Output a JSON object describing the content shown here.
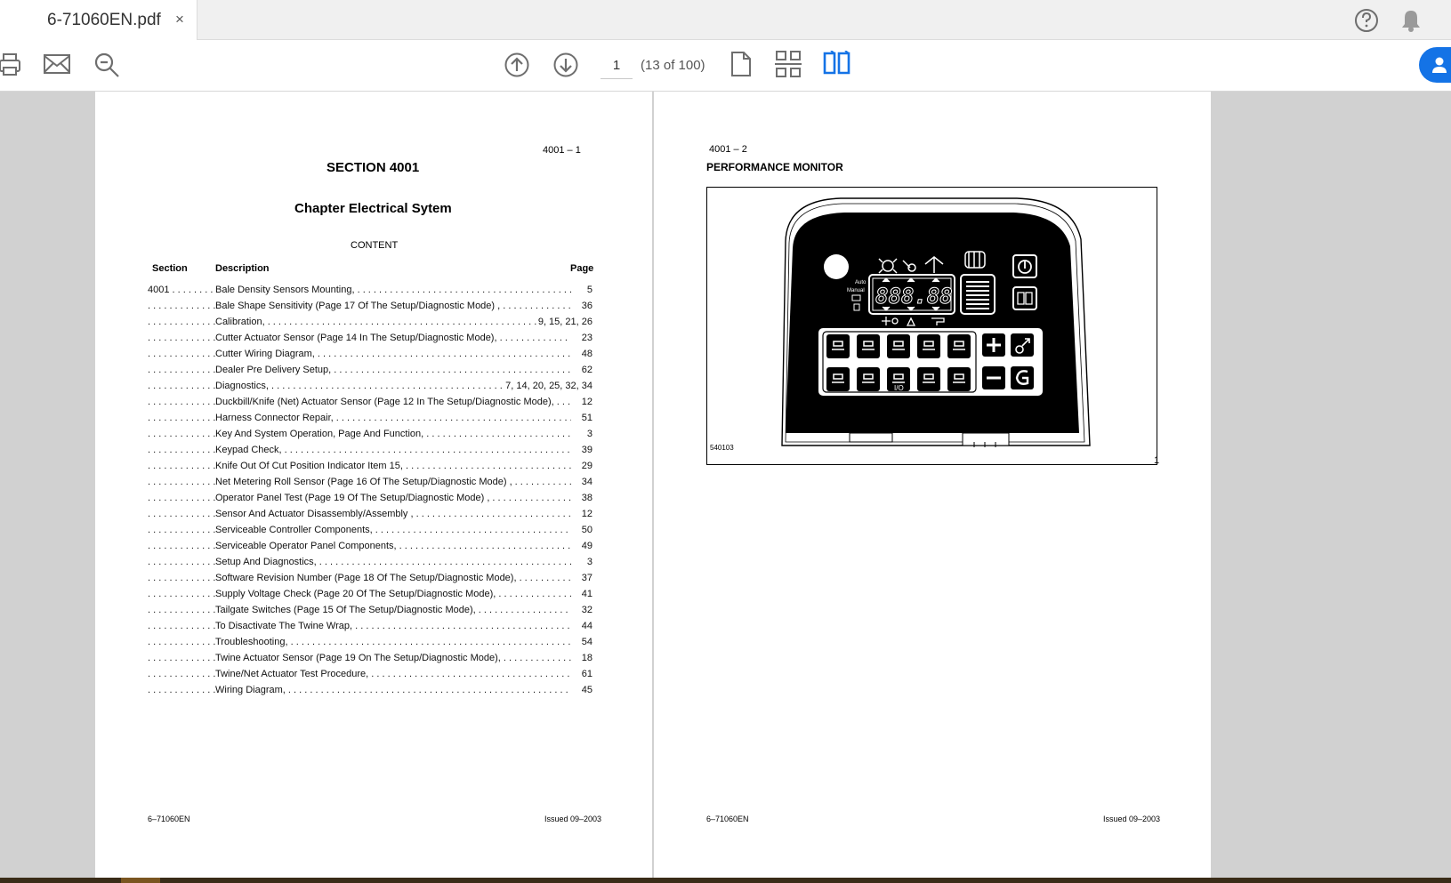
{
  "tab": {
    "title": "6-71060EN.pdf",
    "close": "×"
  },
  "toolbar": {
    "page_input": "1",
    "page_count": "(13 of 100)"
  },
  "left_page": {
    "header_code": "4001 – 1",
    "section_title": "SECTION  4001",
    "chapter_title": "Chapter  Electrical Sytem",
    "content_label": "CONTENT",
    "col_section": "Section",
    "col_description": "Description",
    "col_page": "Page",
    "toc": [
      {
        "sec": "4001 . . . . . . . . . . . . . .",
        "desc": "Bale Density Sensors Mounting,  . . . . . . . . . . . . . . . . . . . . . . . . . . . . . . . . . . . . . . . . . . . . . . . . . . . . . . . . . . .",
        "page": "5"
      },
      {
        "sec": ". . . . . . . . . . . . . . . . . . . .",
        "desc": "Bale Shape Sensitivity (Page 17 Of The  Setup/Diagnostic Mode) ,  . . . . . . . . . . . . . . . . . . . . . . . . . . . . .",
        "page": "36"
      },
      {
        "sec": ". . . . . . . . . . . . . . . . . . . .",
        "desc": "Calibration,  . . . . . . . . . . . . . . . . . . . . . . . . . . . . . . . . . . . . . . . . . . . . . . . . . . . . . . . . . . . . . . . . . . . . . . . . . . .",
        "page": "9, 15, 21, 26"
      },
      {
        "sec": ". . . . . . . . . . . . . . . . . . . .",
        "desc": "Cutter Actuator Sensor (Page 14 In The  Setup/Diagnostic Mode),  . . . . . . . . . . . . . . . . . . . . . . . . . . . . .",
        "page": "23"
      },
      {
        "sec": ". . . . . . . . . . . . . . . . . . . .",
        "desc": "Cutter Wiring Diagram,  . . . . . . . . . . . . . . . . . . . . . . . . . . . . . . . . . . . . . . . . . . . . . . . . . . . . . . . . . . . . . . . .",
        "page": "48"
      },
      {
        "sec": ". . . . . . . . . . . . . . . . . . . .",
        "desc": "Dealer Pre Delivery Setup,  . . . . . . . . . . . . . . . . . . . . . . . . . . . . . . . . . . . . . . . . . . . . . . . . . . . . . . . . . . . . .",
        "page": "62"
      },
      {
        "sec": ". . . . . . . . . . . . . . . . . . . .",
        "desc": "Diagnostics,  . . . . . . . . . . . . . . . . . . . . . . . . . . . . . . . . . . . . . . . . . . . . . . . . . . . . . . . . . . . . . . . . . . . . . . . . . . . .",
        "page": "7, 14, 20, 25, 32, 34"
      },
      {
        "sec": ". . . . . . . . . . . . . . . . . . . .",
        "desc": "Duckbill/Knife (Net) Actuator Sensor (Page 12 In The Setup/Diagnostic Mode),  . . . . . . . . . . . .",
        "page": "12"
      },
      {
        "sec": ". . . . . . . . . . . . . . . . . . . .",
        "desc": "Harness Connector Repair,  . . . . . . . . . . . . . . . . . . . . . . . . . . . . . . . . . . . . . . . . . . . . . . . . . . . . . . . . . . . . .",
        "page": "51"
      },
      {
        "sec": ". . . . . . . . . . . . . . . . . . . .",
        "desc": "Key And System Operation, Page And Function,  . . . . . . . . . . . . . . . . . . . . . . . . . . . . . . . . . . . . . . . . . . . . .",
        "page": "3"
      },
      {
        "sec": ". . . . . . . . . . . . . . . . . . . .",
        "desc": "Keypad Check,  . . . . . . . . . . . . . . . . . . . . . . . . . . . . . . . . . . . . . . . . . . . . . . . . . . . . . . . . . . . . . . . . . . . . . . .",
        "page": "39"
      },
      {
        "sec": ". . . . . . . . . . . . . . . . . . . .",
        "desc": "Knife Out Of Cut Position Indicator Item 15,  . . . . . . . . . . . . . . . . . . . . . . . . . . . . . . . . . . . . . . . . . . . . . . . .",
        "page": "29"
      },
      {
        "sec": ". . . . . . . . . . . . . . . . . . . .",
        "desc": "Net Metering Roll Sensor (Page 16 Of The Setup/Diagnostic Mode) ,  . . . . . . . . . . . . . . . . . . . . . . . . . . . .",
        "page": "34"
      },
      {
        "sec": ". . . . . . . . . . . . . . . . . . . .",
        "desc": "Operator Panel Test (Page 19 Of The Setup/Diagnostic Mode) ,  . . . . . . . . . . . . . . . . . . . . . . . . . . . . . . . .",
        "page": "38"
      },
      {
        "sec": ". . . . . . . . . . . . . . . . . . . .",
        "desc": "Sensor And Actuator Disassembly/Assembly ,  . . . . . . . . . . . . . . . . . . . . . . . . . . . . . . . . . . . . . . . . . . . . . . . .",
        "page": "12"
      },
      {
        "sec": ". . . . . . . . . . . . . . . . . . . .",
        "desc": "Serviceable Controller Components,  . . . . . . . . . . . . . . . . . . . . . . . . . . . . . . . . . . . . . . . . . . . . . . . . . . . . . . .",
        "page": "50"
      },
      {
        "sec": ". . . . . . . . . . . . . . . . . . . .",
        "desc": "Serviceable Operator Panel Components,  . . . . . . . . . . . . . . . . . . . . . . . . . . . . . . . . . . . . . . . . . . . . . . . . . . . .",
        "page": "49"
      },
      {
        "sec": ". . . . . . . . . . . . . . . . . . . .",
        "desc": "Setup And Diagnostics,  . . . . . . . . . . . . . . . . . . . . . . . . . . . . . . . . . . . . . . . . . . . . . . . . . . . . . . . . . . . . . . . . .",
        "page": "3"
      },
      {
        "sec": ". . . . . . . . . . . . . . . . . . . .",
        "desc": "Software Revision Number (Page 18 Of The Setup/Diagnostic Mode),  . . . . . . . . . . . . . . . . . . . . . . . . . . . .",
        "page": "37"
      },
      {
        "sec": ". . . . . . . . . . . . . . . . . . . .",
        "desc": "Supply Voltage Check (Page 20 Of The Setup/Diagnostic Mode),  . . . . . . . . . . . . . . . . . . . . . . . . . . . . . . . .",
        "page": "41"
      },
      {
        "sec": ". . . . . . . . . . . . . . . . . . . .",
        "desc": "Tailgate Switches (Page 15 Of The Setup/Diagnostic Mode),  . . . . . . . . . . . . . . . . . . . . . . . . . . . . . . . . . . . .",
        "page": "32"
      },
      {
        "sec": ". . . . . . . . . . . . . . . . . . . .",
        "desc": "To Disactivate The Twine Wrap,  . . . . . . . . . . . . . . . . . . . . . . . . . . . . . . . . . . . . . . . . . . . . . . . . . . . . . . . . . .",
        "page": "44"
      },
      {
        "sec": ". . . . . . . . . . . . . . . . . . . .",
        "desc": "Troubleshooting,  . . . . . . . . . . . . . . . . . . . . . . . . . . . . . . . . . . . . . . . . . . . . . . . . . . . . . . . . . . . . . . . . . . . . . .",
        "page": "54"
      },
      {
        "sec": ". . . . . . . . . . . . . . . . . . . .",
        "desc": "Twine Actuator Sensor (Page 19 On The Setup/Diagnostic Mode),  . . . . . . . . . . . . . . . . . . . . . . . . . . . . . . .",
        "page": "18"
      },
      {
        "sec": ". . . . . . . . . . . . . . . . . . . .",
        "desc": "Twine/Net Actuator Test Procedure,  . . . . . . . . . . . . . . . . . . . . . . . . . . . . . . . . . . . . . . . . . . . . . . . . . . . . . . .",
        "page": "61"
      },
      {
        "sec": ". . . . . . . . . . . . . . . . . . . .",
        "desc": "Wiring Diagram,  . . . . . . . . . . . . . . . . . . . . . . . . . . . . . . . . . . . . . . . . . . . . . . . . . . . . . . . . . . . . . . . . . . . . . . .",
        "page": "45"
      }
    ],
    "footer_left": "6–71060EN",
    "footer_right": "Issued 09–2003"
  },
  "right_page": {
    "header_code": "4001 – 2",
    "title": "PERFORMANCE MONITOR",
    "figure_code": "540103",
    "figure_number": "1",
    "display_digits": "888.88",
    "auto_label": "Auto",
    "manual_label": "Manual",
    "io_label": "I/O",
    "footer_left": "6–71060EN",
    "footer_right": "Issued 09–2003"
  },
  "icons": [
    "print-icon",
    "mail-icon",
    "zoom-icon",
    "arrow-up-icon",
    "arrow-down-icon",
    "single-page-icon",
    "scroll-icon",
    "two-page-icon",
    "help-icon",
    "bell-icon",
    "share-icon"
  ],
  "colors": {
    "accent": "#1473e6",
    "page_bg": "#ffffff",
    "viewer_bg": "#d1d1d1"
  }
}
